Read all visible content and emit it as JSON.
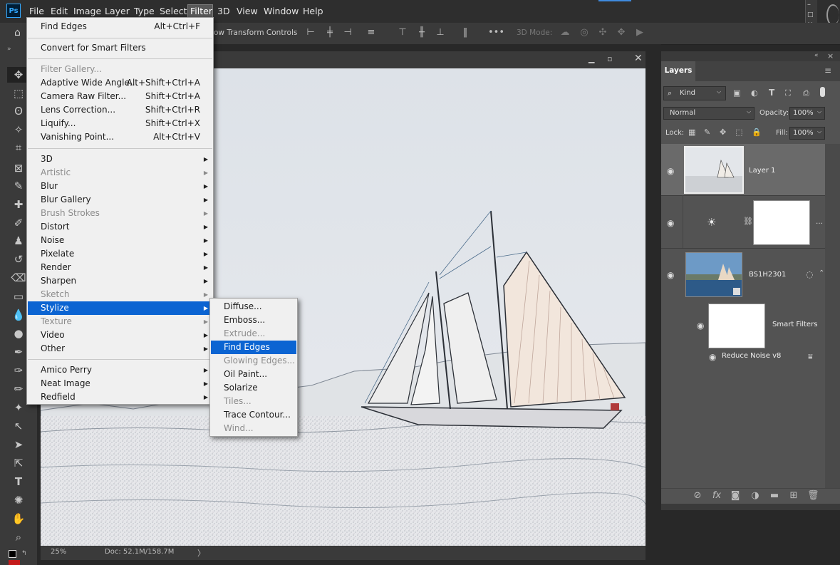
{
  "app": {
    "logo": "Ps",
    "menubar": [
      "File",
      "Edit",
      "Image",
      "Layer",
      "Type",
      "Select",
      "Filter",
      "3D",
      "View",
      "Window",
      "Help"
    ],
    "active_menu": "Filter"
  },
  "options_bar": {
    "transform_text": "ow Transform Controls",
    "mode_label": "3D Mode:"
  },
  "document": {
    "zoom": "25%",
    "doc_info": "Doc: 52.1M/158.7M"
  },
  "filter_menu": {
    "items": [
      {
        "label": "Find Edges",
        "shortcut": "Alt+Ctrl+F"
      },
      {
        "label": "Convert for Smart Filters"
      },
      {
        "label": "Filter Gallery...",
        "disabled": true
      },
      {
        "label": "Adaptive Wide Angle...",
        "shortcut": "Alt+Shift+Ctrl+A"
      },
      {
        "label": "Camera Raw Filter...",
        "shortcut": "Shift+Ctrl+A"
      },
      {
        "label": "Lens Correction...",
        "shortcut": "Shift+Ctrl+R"
      },
      {
        "label": "Liquify...",
        "shortcut": "Shift+Ctrl+X"
      },
      {
        "label": "Vanishing Point...",
        "shortcut": "Alt+Ctrl+V"
      },
      {
        "label": "3D",
        "submenu": true
      },
      {
        "label": "Artistic",
        "submenu": true,
        "disabled": true
      },
      {
        "label": "Blur",
        "submenu": true
      },
      {
        "label": "Blur Gallery",
        "submenu": true
      },
      {
        "label": "Brush Strokes",
        "submenu": true,
        "disabled": true
      },
      {
        "label": "Distort",
        "submenu": true
      },
      {
        "label": "Noise",
        "submenu": true
      },
      {
        "label": "Pixelate",
        "submenu": true
      },
      {
        "label": "Render",
        "submenu": true
      },
      {
        "label": "Sharpen",
        "submenu": true
      },
      {
        "label": "Sketch",
        "submenu": true,
        "disabled": true
      },
      {
        "label": "Stylize",
        "submenu": true,
        "highlighted": true
      },
      {
        "label": "Texture",
        "submenu": true,
        "disabled": true
      },
      {
        "label": "Video",
        "submenu": true
      },
      {
        "label": "Other",
        "submenu": true
      },
      {
        "label": "Amico Perry",
        "submenu": true
      },
      {
        "label": "Neat Image",
        "submenu": true
      },
      {
        "label": "Redfield",
        "submenu": true
      }
    ]
  },
  "stylize_menu": {
    "items": [
      {
        "label": "Diffuse..."
      },
      {
        "label": "Emboss..."
      },
      {
        "label": "Extrude...",
        "disabled": true
      },
      {
        "label": "Find Edges",
        "highlighted": true
      },
      {
        "label": "Glowing Edges...",
        "disabled": true
      },
      {
        "label": "Oil Paint..."
      },
      {
        "label": "Solarize"
      },
      {
        "label": "Tiles...",
        "disabled": true
      },
      {
        "label": "Trace Contour..."
      },
      {
        "label": "Wind...",
        "disabled": true
      }
    ]
  },
  "layers_panel": {
    "tab": "Layers",
    "kind_filter": "Kind",
    "blend_mode": "Normal",
    "opacity_label": "Opacity:",
    "opacity": "100%",
    "lock_label": "Lock:",
    "fill_label": "Fill:",
    "fill": "100%",
    "layers": [
      {
        "name": "Layer 1"
      },
      {
        "name": ""
      },
      {
        "name": "BS1H2301"
      }
    ],
    "smart_filters_label": "Smart Filters",
    "smart_filter_item": "Reduce Noise v8"
  },
  "colors": {
    "menu_highlight": "#0b64d2",
    "panel_bg": "#535353",
    "app_bg": "#282828"
  }
}
